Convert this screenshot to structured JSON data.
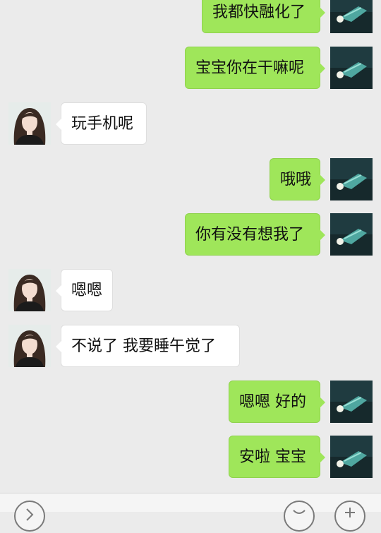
{
  "messages": [
    {
      "side": "out",
      "text": "我都快融化了"
    },
    {
      "side": "out",
      "text": "宝宝你在干嘛呢"
    },
    {
      "side": "in",
      "text": "玩手机呢"
    },
    {
      "side": "out",
      "text": "哦哦"
    },
    {
      "side": "out",
      "text": "你有没有想我了"
    },
    {
      "side": "in",
      "text": "嗯嗯"
    },
    {
      "side": "in",
      "text": "不说了  我要睡午觉了"
    },
    {
      "side": "out",
      "text": "嗯嗯  好的"
    },
    {
      "side": "out",
      "text": "安啦  宝宝"
    }
  ],
  "colors": {
    "background": "#ebebeb",
    "outgoing_bubble": "#9fe65a",
    "incoming_bubble": "#ffffff"
  },
  "icons": {
    "voice_toggle": "voice-icon",
    "emoji": "emoji-icon",
    "more": "plus-icon"
  }
}
